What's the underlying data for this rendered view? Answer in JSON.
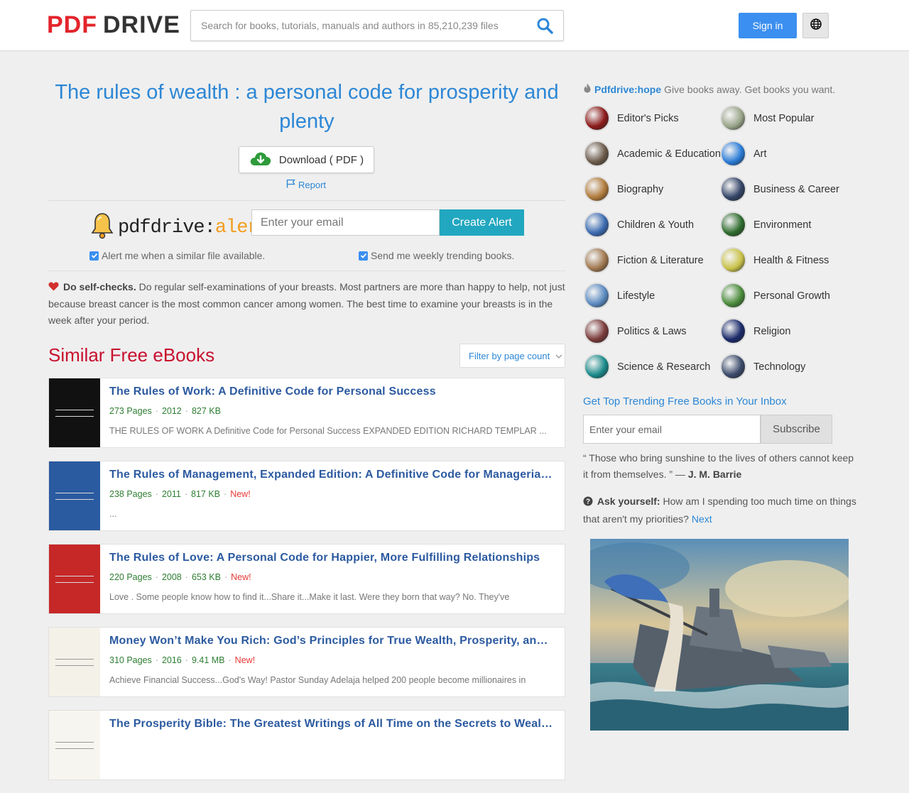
{
  "header": {
    "logo_pdf": "PDF",
    "logo_drive": "DRIVE",
    "search_placeholder": "Search for books, tutorials, manuals and authors in 85,210,239 files",
    "signin_label": "Sign in"
  },
  "book": {
    "title": "The rules of wealth : a personal code for prosperity and plenty",
    "download_label": "Download ( PDF )",
    "report_label": "Report"
  },
  "alerts": {
    "brand_1": "pdfdrive:",
    "brand_2": "alerts",
    "email_placeholder": "Enter your email",
    "create_label": "Create Alert",
    "check_similar": "Alert me when a similar file available.",
    "check_weekly": "Send me weekly trending books."
  },
  "tip": {
    "title": "Do self-checks.",
    "text": " Do regular self-examinations of your breasts. Most partners are more than happy to help, not just because breast cancer is the most common cancer among women. The best time to examine your breasts is in the week after your period."
  },
  "similar": {
    "heading": "Similar Free eBooks",
    "filter_label": "Filter by page count",
    "books": [
      {
        "title": "The Rules of Work: A Definitive Code for Personal Success",
        "pages": "273 Pages",
        "year": "2012",
        "size": "827 KB",
        "is_new": false,
        "new_label": "",
        "excerpt": "THE RULES OF WORK A Definitive Code for Personal Success EXPANDED EDITION RICHARD TEMPLAR  ...",
        "cover_color": "#111111"
      },
      {
        "title": "The Rules of Management, Expanded Edition: A Definitive Code for Managerial Success",
        "pages": "238 Pages",
        "year": "2011",
        "size": "817 KB",
        "is_new": true,
        "new_label": "New!",
        "excerpt": " ...",
        "cover_color": "#2a5aa0"
      },
      {
        "title": "The Rules of Love: A Personal Code for Happier, More Fulfilling Relationships",
        "pages": "220 Pages",
        "year": "2008",
        "size": "653 KB",
        "is_new": true,
        "new_label": "New!",
        "excerpt": "Love .   Some people know how to find it...Share it...Make it last.    Were they born that way? No. They've",
        "cover_color": "#c62828"
      },
      {
        "title": "Money Won’t Make You Rich: God’s Principles for True Wealth, Prosperity, and Success",
        "pages": "310 Pages",
        "year": "2016",
        "size": "9.41 MB",
        "is_new": true,
        "new_label": "New!",
        "excerpt": "Achieve Financial Success...God's Way! Pastor Sunday Adelaja helped 200 people become millionaires in",
        "cover_color": "#f4f1e8"
      },
      {
        "title": "The Prosperity Bible: The Greatest Writings of All Time on the Secrets to Wealth and Prosperity",
        "pages": "",
        "year": "",
        "size": "",
        "is_new": false,
        "new_label": "",
        "excerpt": "",
        "cover_color": "#f7f5ef"
      }
    ]
  },
  "sidebar": {
    "hope_link": "Pdfdrive:hope",
    "hope_text": "Give books away. Get books you want.",
    "categories": [
      {
        "label": "Editor's Picks",
        "icon": "editors-picks-icon",
        "color": "#8b1a1a"
      },
      {
        "label": "Most Popular",
        "icon": "most-popular-icon",
        "color": "#9aa58a"
      },
      {
        "label": "Academic & Education",
        "icon": "academic-icon",
        "color": "#6b5a4a"
      },
      {
        "label": "Art",
        "icon": "art-icon",
        "color": "#2a7bd6"
      },
      {
        "label": "Biography",
        "icon": "biography-icon",
        "color": "#b07a3a"
      },
      {
        "label": "Business & Career",
        "icon": "business-icon",
        "color": "#334466"
      },
      {
        "label": "Children & Youth",
        "icon": "children-icon",
        "color": "#3a6ab0"
      },
      {
        "label": "Environment",
        "icon": "environment-icon",
        "color": "#2e6b2e"
      },
      {
        "label": "Fiction & Literature",
        "icon": "fiction-icon",
        "color": "#a07850"
      },
      {
        "label": "Health & Fitness",
        "icon": "health-icon",
        "color": "#c9c24a"
      },
      {
        "label": "Lifestyle",
        "icon": "lifestyle-icon",
        "color": "#5a8ac0"
      },
      {
        "label": "Personal Growth",
        "icon": "personal-growth-icon",
        "color": "#4a8a3a"
      },
      {
        "label": "Politics & Laws",
        "icon": "politics-icon",
        "color": "#7a3a3a"
      },
      {
        "label": "Religion",
        "icon": "religion-icon",
        "color": "#1a2a6a"
      },
      {
        "label": "Science & Research",
        "icon": "science-icon",
        "color": "#1a8a8a"
      },
      {
        "label": "Technology",
        "icon": "technology-icon",
        "color": "#3a4a6a"
      }
    ],
    "trending_heading": "Get Top Trending Free Books in Your Inbox",
    "subscribe_placeholder": "Enter your email",
    "subscribe_label": "Subscribe",
    "quote_text": "“ Those who bring sunshine to the lives of others cannot keep it from themselves. ” —",
    "quote_author": "J. M. Barrie",
    "ask_title": "Ask yourself:",
    "ask_text": " How am I spending too much time on things that aren't my priorities?",
    "ask_next": "Next"
  },
  "colors": {
    "brand_red": "#e3242b",
    "link_blue": "#2c87d6",
    "title_blue": "#2c5aa0",
    "alert_teal": "#22a7c0",
    "signin_blue": "#3b8ff0",
    "meta_green": "#2e7d32",
    "heading_red": "#c8102e"
  }
}
